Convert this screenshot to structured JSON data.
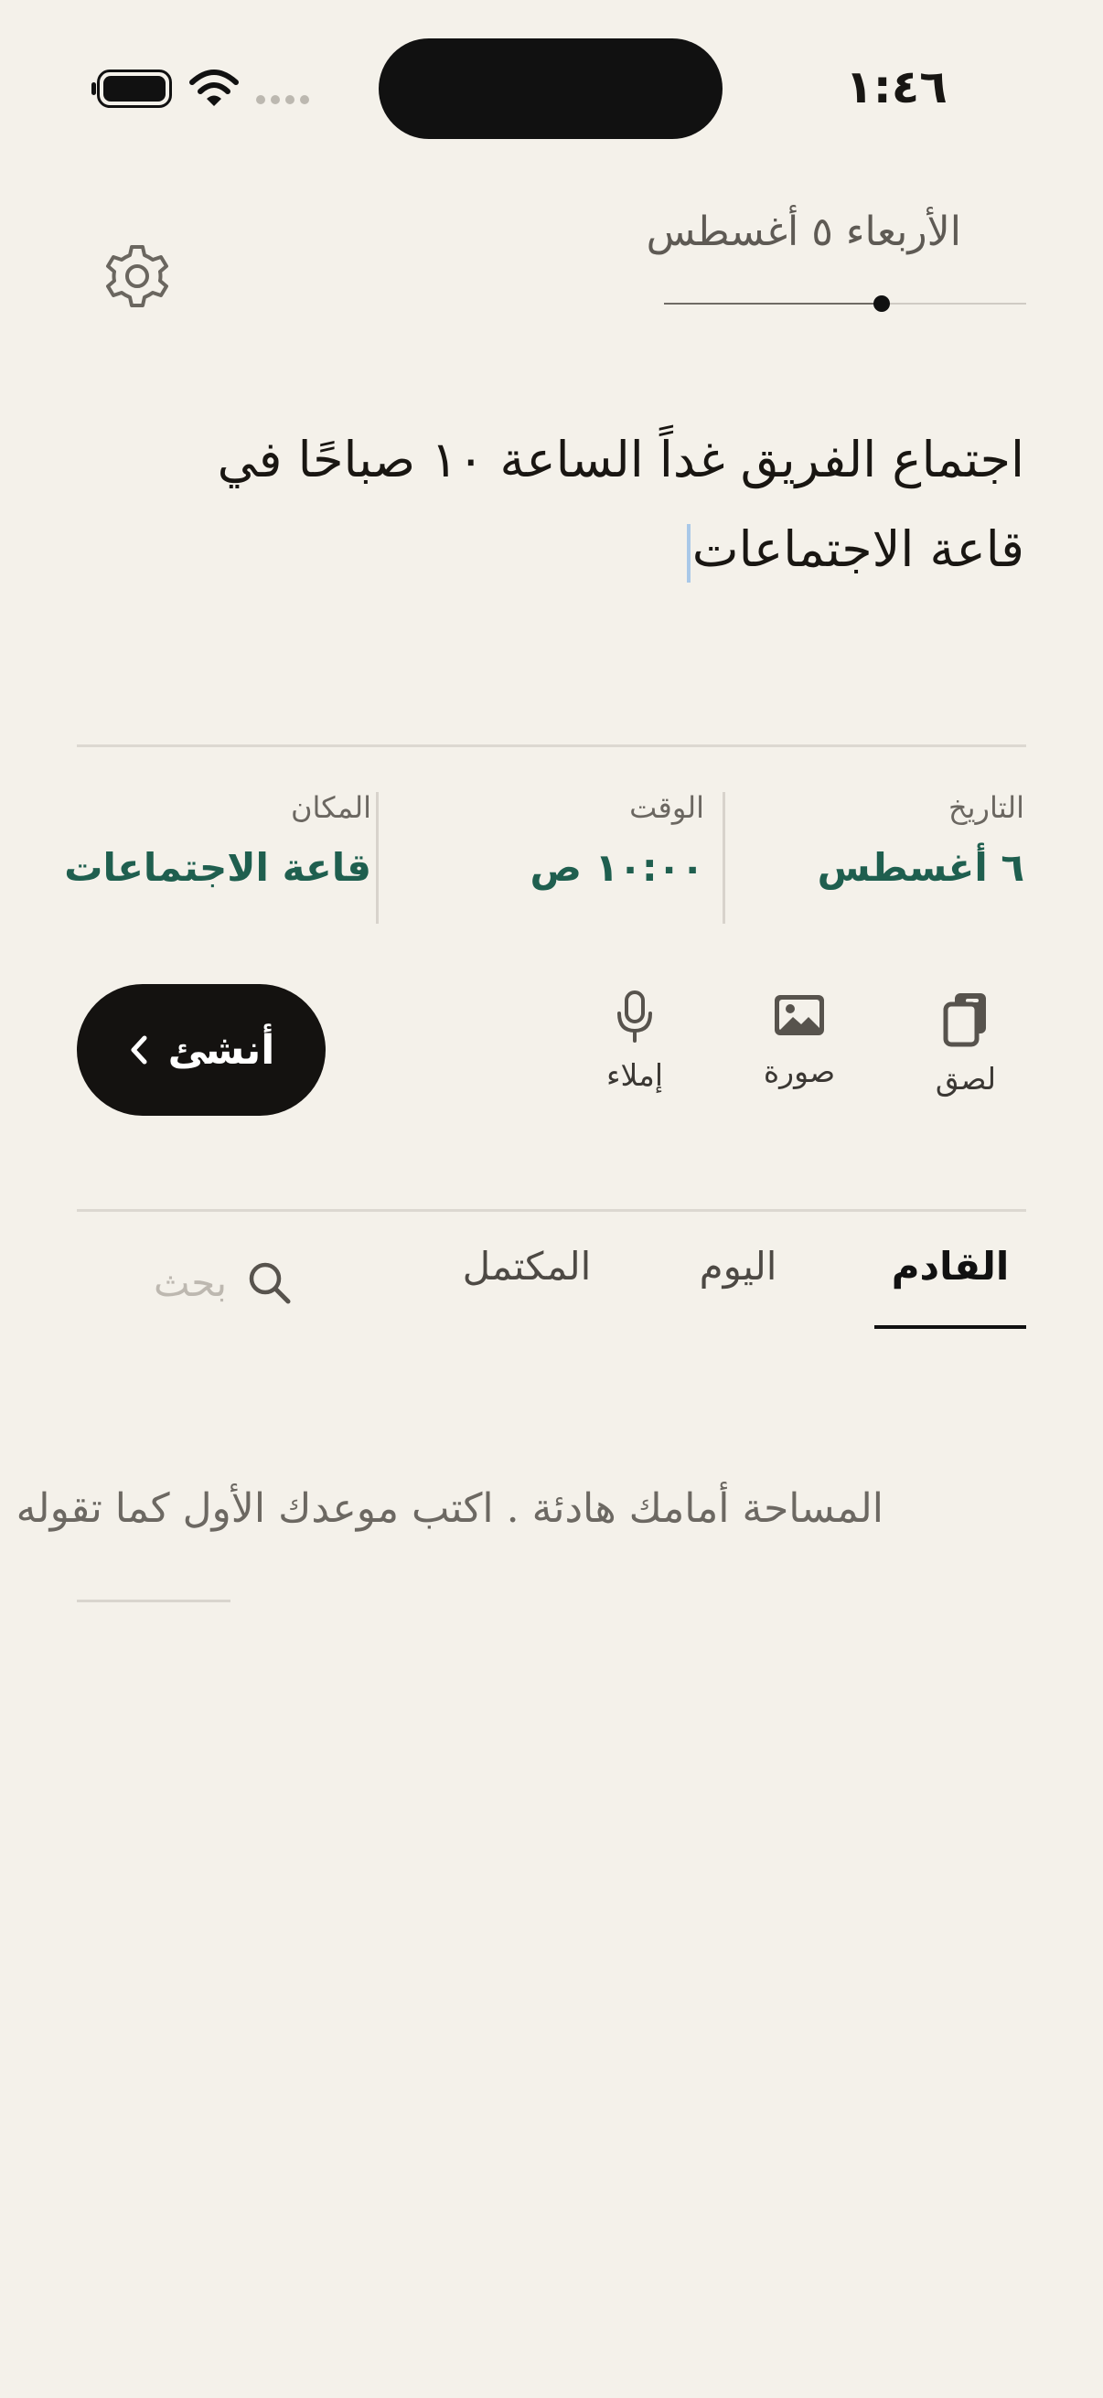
{
  "status_bar": {
    "time": "١:٤٦"
  },
  "header": {
    "date": "الأربعاء ٥ أغسطس",
    "date_slider_fraction": 0.6
  },
  "input": {
    "text": "اجتماع الفريق غداً الساعة ١٠ صباحًا في قاعة الاجتماعات"
  },
  "fields": {
    "date": {
      "label": "التاريخ",
      "value": "٦ أغسطس"
    },
    "time": {
      "label": "الوقت",
      "value": "١٠:٠٠ ص"
    },
    "place": {
      "label": "المكان",
      "value": "قاعة الاجتماعات"
    }
  },
  "actions": {
    "paste": "لصق",
    "photo": "صورة",
    "dictate": "إملاء",
    "create": "أنشئ"
  },
  "tabs": [
    {
      "label": "القادم",
      "active": true
    },
    {
      "label": "اليوم",
      "active": false
    },
    {
      "label": "المكتمل",
      "active": false
    }
  ],
  "search": {
    "placeholder": "بحث"
  },
  "empty_state": {
    "text": "المساحة أمامك هادئة . اكتب موعدك الأول كما تقوله ."
  }
}
